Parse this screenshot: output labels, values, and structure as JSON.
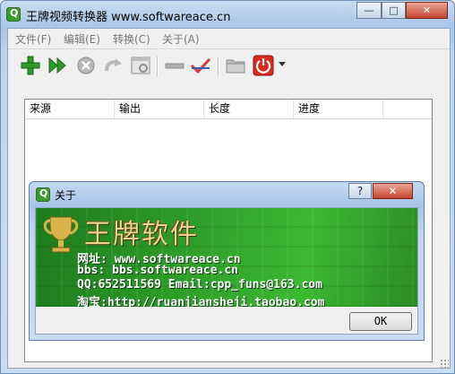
{
  "window": {
    "title": "王牌视频转换器  www.softwareace.cn",
    "minimize_glyph": "—",
    "maximize_glyph": "□",
    "close_glyph": "✕"
  },
  "menu": [
    {
      "label": "文件(F)"
    },
    {
      "label": "编辑(E)"
    },
    {
      "label": "转换(C)"
    },
    {
      "label": "关于(A)"
    }
  ],
  "toolbar": {
    "buttons": [
      {
        "icon": "add-icon"
      },
      {
        "icon": "convert-icon"
      },
      {
        "icon": "stop-icon"
      },
      {
        "icon": "redo-icon"
      },
      {
        "icon": "settings-window-icon"
      },
      {
        "icon": "remove-icon"
      },
      {
        "icon": "check-icon"
      },
      {
        "icon": "folder-icon"
      },
      {
        "icon": "power-icon"
      }
    ]
  },
  "list": {
    "columns": [
      "来源",
      "输出",
      "长度",
      "进度"
    ]
  },
  "dialog": {
    "title": "关于",
    "help_glyph": "?",
    "close_glyph": "✕",
    "brand": "王牌软件",
    "lines": [
      "网址: www.softwareace.cn",
      "bbs: bbs.softwareace.cn",
      "QQ:652511569   Email:cpp_funs@163.com",
      "淘宝:http://ruanjiansheji.taobao.com"
    ],
    "ok_label": "OK"
  },
  "colors": {
    "banner_green": "#2e9e2a",
    "brand_gold": "#e8d48a"
  }
}
